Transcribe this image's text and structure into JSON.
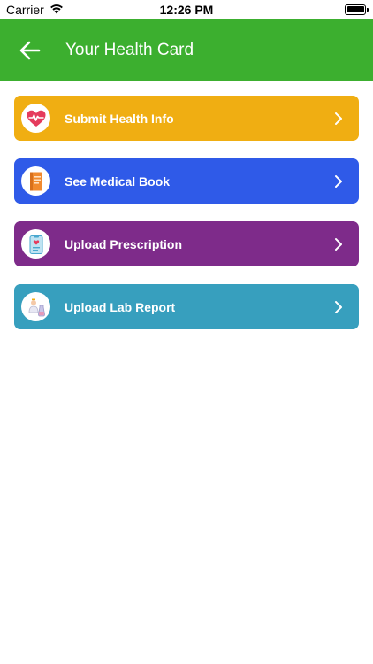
{
  "status": {
    "carrier": "Carrier",
    "time": "12:26 PM"
  },
  "header": {
    "title": "Your Health Card",
    "back_icon": "arrow-left-icon"
  },
  "colors": {
    "header": "#3caf2f",
    "submit": "#f0ae12",
    "medical_book": "#2f5ae8",
    "prescription": "#7e2b8a",
    "lab_report": "#379fbe"
  },
  "menu": {
    "items": [
      {
        "label": "Submit Health Info",
        "icon": "heart-pulse-icon"
      },
      {
        "label": "See Medical Book",
        "icon": "book-icon"
      },
      {
        "label": "Upload Prescription",
        "icon": "clipboard-icon"
      },
      {
        "label": "Upload Lab Report",
        "icon": "lab-flask-icon"
      }
    ]
  }
}
